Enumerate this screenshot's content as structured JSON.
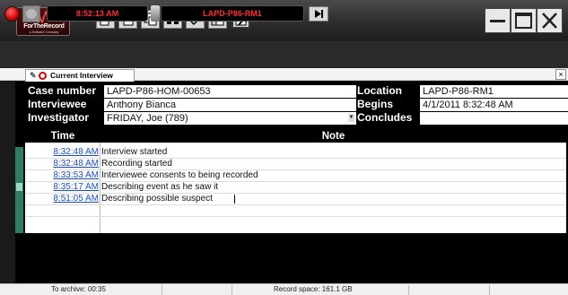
{
  "app": {
    "brand": "ForTheRecord",
    "brand_sub": "a Software Company"
  },
  "toolbar_icons": [
    "report-icon",
    "new-page-icon",
    "copy-icon",
    "binoculars-icon",
    "spellcheck-icon",
    "paste-icon",
    "edit-icon"
  ],
  "recorder": {
    "time": "8:52:13 AM",
    "room": "LAPD-P86-RM1"
  },
  "tab": {
    "label": "Current Interview",
    "close": "×"
  },
  "header": {
    "case_number_label": "Case number",
    "case_number": "LAPD-P86-HOM-00653",
    "interviewee_label": "Interviewee",
    "interviewee": "Anthony Bianca",
    "investigator_label": "Investigator",
    "investigator": "FRIDAY, Joe (789)",
    "location_label": "Location",
    "location": "LAPD-P86-RM1",
    "begins_label": "Begins",
    "begins": "4/1/2011 8:32:48 AM",
    "concludes_label": "Concludes",
    "concludes": ""
  },
  "notes": {
    "time_header": "Time",
    "note_header": "Note",
    "rows": [
      {
        "time": "8:32:48 AM",
        "note": "Interview started"
      },
      {
        "time": "8:32:48 AM",
        "note": "Recording started"
      },
      {
        "time": "8:33:53 AM",
        "note": "Interviewee consents to being recorded"
      },
      {
        "time": "8:35:17 AM",
        "note": "Describing event as he saw it"
      },
      {
        "time": "8:51:05 AM",
        "note": "Describing possible suspect"
      }
    ]
  },
  "status": {
    "archive": "To archive: 00:35",
    "space": "Record space: 161.1 GB"
  },
  "colors": {
    "record_red": "#d40000",
    "display_red": "#ff2d2d",
    "link_blue": "#1b4fd0",
    "gutter_green": "#2f7d60"
  }
}
